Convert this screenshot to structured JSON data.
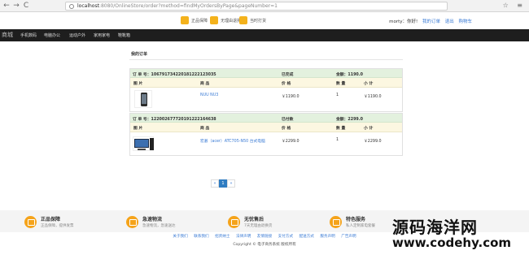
{
  "browser": {
    "url_prefix": "localhost",
    "url_rest": ":8080/OnlineStore/order?method=findMyOrdersByPage&pageNumber=1",
    "back": "←",
    "forward": "→",
    "reload": "C"
  },
  "services": [
    {
      "label": "正品保障"
    },
    {
      "label": "无理由退换"
    },
    {
      "label": "当时打货"
    }
  ],
  "user": {
    "greeting": "morty：你好!",
    "orders_link": "我的订单",
    "logout_link": "退出",
    "cart_link": "购物车"
  },
  "nav": {
    "logo": "商城",
    "items": [
      "手机数码",
      "电脑办公",
      "运动户外",
      "家用家电",
      "鞋靴箱"
    ]
  },
  "page": {
    "title": "我的订单"
  },
  "columns": {
    "image": "图 片",
    "name": "商 品",
    "price": "价 格",
    "qty": "数 量",
    "subtotal": "小 计"
  },
  "orders": [
    {
      "order_no": "订 单 号：106791734220181222123035",
      "status": "已完成",
      "amount": "金额：1190.0",
      "item": {
        "name": "NUU NU3",
        "price": "￥1190.0",
        "qty": "1",
        "subtotal": "￥1190.0"
      }
    },
    {
      "order_no": "订 单 号：12200267772019122216463​8",
      "status": "已付款",
      "amount": "金额：2299.0",
      "item": {
        "name": "宏碁（acer）ATC705-N50 台式电脑",
        "price": "￥2299.0",
        "qty": "1",
        "subtotal": "￥2299.0"
      }
    }
  ],
  "pager": {
    "prev": "«",
    "current": "1",
    "next": "»"
  },
  "footer": {
    "features": [
      {
        "title": "正品保障",
        "sub": "正品保障，提供发票"
      },
      {
        "title": "急速物流",
        "sub": "急速物流，急速送达"
      },
      {
        "title": "无忧售后",
        "sub": "7天无理由退换货"
      },
      {
        "title": "特色服务",
        "sub": "私人定制家电套餐"
      }
    ],
    "links": [
      "关于我们",
      "联系我们",
      "招贤纳士",
      "法律声明",
      "友情链接",
      "支付方式",
      "配送方式",
      "服务声明",
      "广告声明"
    ],
    "copyright": "Copyright © 电子商务系统 版权所有"
  },
  "watermark": {
    "line1": "源码海洋网",
    "line2": "www.codehy.com"
  }
}
